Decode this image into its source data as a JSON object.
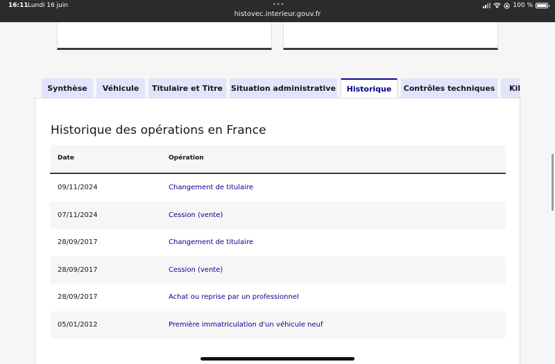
{
  "status_bar": {
    "time": "16:11",
    "date": "Lundi 16 juin",
    "url": "histovec.interieur.gouv.fr",
    "battery": "100 %"
  },
  "tabs": [
    {
      "label": "Synthèse",
      "active": false
    },
    {
      "label": "Véhicule",
      "active": false
    },
    {
      "label": "Titulaire et Titre",
      "active": false
    },
    {
      "label": "Situation administrative",
      "active": false
    },
    {
      "label": "Historique",
      "active": true
    },
    {
      "label": "Contrôles techniques",
      "active": false
    },
    {
      "label": "Kil",
      "active": false
    }
  ],
  "section": {
    "title": "Historique des opérations en France",
    "columns": {
      "date": "Date",
      "operation": "Opération"
    },
    "rows": [
      {
        "date": "09/11/2024",
        "operation": "Changement de titulaire"
      },
      {
        "date": "07/11/2024",
        "operation": "Cession (vente)"
      },
      {
        "date": "28/09/2017",
        "operation": "Changement de titulaire"
      },
      {
        "date": "28/09/2017",
        "operation": "Cession (vente)"
      },
      {
        "date": "28/09/2017",
        "operation": "Achat ou reprise par un professionnel"
      },
      {
        "date": "05/01/2012",
        "operation": "Première immatriculation d'un véhicule neuf"
      }
    ]
  },
  "colors": {
    "accent": "#000091",
    "tab_bg": "#e3e3fd",
    "row_alt": "#f6f6f6"
  }
}
